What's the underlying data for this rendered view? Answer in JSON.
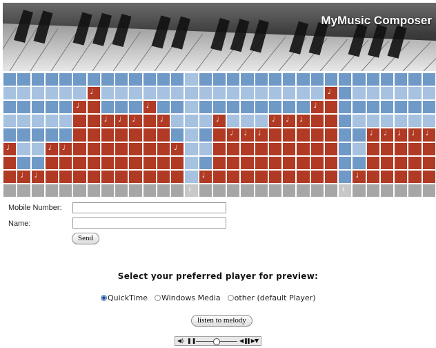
{
  "app": {
    "title": "MyMusic Composer"
  },
  "colors": {
    "note_on": "#b03a24",
    "cell_dark_blue": "#6f99c6",
    "cell_light_blue": "#a6c2e0",
    "rest_row": "#a6a6a6",
    "selected_rest": "#c8c8c8"
  },
  "composer": {
    "rows": 8,
    "cols": 31,
    "column_heights": [
      3,
      1,
      1,
      3,
      3,
      6,
      7,
      5,
      5,
      5,
      6,
      5,
      3,
      5,
      1,
      5,
      4,
      4,
      4,
      5,
      5,
      5,
      6,
      7,
      6,
      1,
      4,
      4,
      4,
      4,
      4,
      6
    ],
    "rests": [
      13,
      24
    ],
    "note_icon": "♩",
    "rest_icon": "𝄽"
  },
  "form": {
    "mobile_label": "Mobile Number:",
    "mobile_value": "",
    "name_label": "Name:",
    "name_value": "",
    "send_label": "Send"
  },
  "player_select": {
    "heading": "Select your preferred player for preview:",
    "options": [
      {
        "label": "QuickTime",
        "checked": true
      },
      {
        "label": "Windows Media",
        "checked": false
      },
      {
        "label": "other (default Player)",
        "checked": false
      }
    ],
    "listen_label": "listen to melody"
  },
  "mini_player": {
    "volume_icon": "speaker-icon",
    "pause_icon": "pause-icon",
    "rewind_icon": "step-back-icon",
    "forward_icon": "step-forward-icon",
    "menu_icon": "dropdown-icon",
    "position": 0.5
  }
}
